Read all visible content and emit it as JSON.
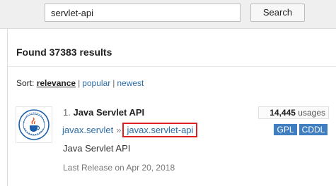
{
  "search": {
    "value": "servlet-api",
    "button_label": "Search"
  },
  "results": {
    "found_text": "Found 37383 results",
    "sort_label": "Sort:",
    "sort_options": [
      "relevance",
      "popular",
      "newest"
    ],
    "sort_selected": "relevance"
  },
  "result_item": {
    "number": "1.",
    "title": "Java Servlet API",
    "group_id": "javax.servlet",
    "separator": "»",
    "artifact_id": "javax.servlet-api",
    "description": "Java Servlet API",
    "last_release": "Last Release on Apr 20, 2018",
    "usages_count": "14,445",
    "usages_label": "usages",
    "licenses": [
      "GPL",
      "CDDL"
    ],
    "logo_icon": "java-community-process-logo-icon"
  },
  "colors": {
    "link": "#2b6da8",
    "license_badge": "#3f7fc1",
    "highlight_box": "#e02020"
  }
}
